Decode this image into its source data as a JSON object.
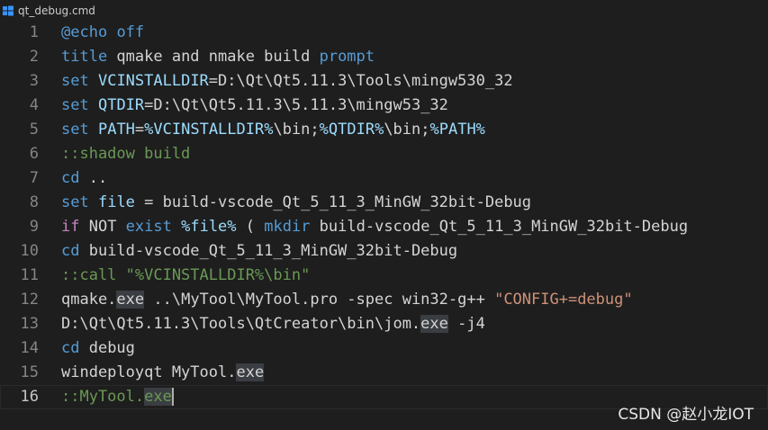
{
  "tab": {
    "label": "qt_debug.cmd",
    "icon": "windows-cmd-icon",
    "icon_color": "#3794ff"
  },
  "editor": {
    "current_line": 16,
    "lines": [
      {
        "n": "1",
        "t": [
          {
            "c": "kw",
            "v": "@echo"
          },
          {
            "v": " "
          },
          {
            "c": "kw",
            "v": "off"
          }
        ]
      },
      {
        "n": "2",
        "t": [
          {
            "c": "kw",
            "v": "title"
          },
          {
            "v": " qmake and nmake build "
          },
          {
            "c": "kw",
            "v": "prompt"
          }
        ]
      },
      {
        "n": "3",
        "t": [
          {
            "c": "kw",
            "v": "set"
          },
          {
            "v": " "
          },
          {
            "c": "var",
            "v": "VCINSTALLDIR"
          },
          {
            "v": "=D:\\Qt\\Qt5.11.3\\Tools\\mingw530_32"
          }
        ]
      },
      {
        "n": "4",
        "t": [
          {
            "c": "kw",
            "v": "set"
          },
          {
            "v": " "
          },
          {
            "c": "var",
            "v": "QTDIR"
          },
          {
            "v": "=D:\\Qt\\Qt5.11.3\\5.11.3\\mingw53_32"
          }
        ]
      },
      {
        "n": "5",
        "t": [
          {
            "c": "kw",
            "v": "set"
          },
          {
            "v": " "
          },
          {
            "c": "var",
            "v": "PATH"
          },
          {
            "v": "="
          },
          {
            "c": "var",
            "v": "%VCINSTALLDIR%"
          },
          {
            "v": "\\bin;"
          },
          {
            "c": "var",
            "v": "%QTDIR%"
          },
          {
            "v": "\\bin;"
          },
          {
            "c": "var",
            "v": "%PATH%"
          }
        ]
      },
      {
        "n": "6",
        "t": [
          {
            "c": "cm",
            "v": "::shadow build"
          }
        ]
      },
      {
        "n": "7",
        "t": [
          {
            "c": "kw",
            "v": "cd"
          },
          {
            "v": " .."
          }
        ]
      },
      {
        "n": "8",
        "t": [
          {
            "c": "kw",
            "v": "set"
          },
          {
            "v": " "
          },
          {
            "c": "var",
            "v": "file"
          },
          {
            "v": " = build-vscode_Qt_5_11_3_MinGW_32bit-Debug"
          }
        ]
      },
      {
        "n": "9",
        "t": [
          {
            "c": "kw2",
            "v": "if"
          },
          {
            "v": " NOT "
          },
          {
            "c": "kw",
            "v": "exist"
          },
          {
            "v": " "
          },
          {
            "c": "var",
            "v": "%file%"
          },
          {
            "v": " ( "
          },
          {
            "c": "kw",
            "v": "mkdir"
          },
          {
            "v": " build-vscode_Qt_5_11_3_MinGW_32bit-Debug"
          }
        ]
      },
      {
        "n": "10",
        "t": [
          {
            "c": "kw",
            "v": "cd"
          },
          {
            "v": " build-vscode_Qt_5_11_3_MinGW_32bit-Debug"
          }
        ]
      },
      {
        "n": "11",
        "t": [
          {
            "c": "cm",
            "v": "::call \"%VCINSTALLDIR%\\bin\""
          }
        ]
      },
      {
        "n": "12",
        "t": [
          {
            "v": "qmake."
          },
          {
            "c": "hl",
            "v": "exe"
          },
          {
            "v": " ..\\MyTool\\MyTool.pro -spec win32-g++ "
          },
          {
            "c": "str",
            "v": "\"CONFIG+=debug\""
          }
        ]
      },
      {
        "n": "13",
        "t": [
          {
            "v": "D:\\Qt\\Qt5.11.3\\Tools\\QtCreator\\bin\\jom."
          },
          {
            "c": "hl",
            "v": "exe"
          },
          {
            "v": " -j4"
          }
        ]
      },
      {
        "n": "14",
        "t": [
          {
            "c": "kw",
            "v": "cd"
          },
          {
            "v": " debug"
          }
        ]
      },
      {
        "n": "15",
        "t": [
          {
            "v": "windeployqt MyTool."
          },
          {
            "c": "hl",
            "v": "exe"
          }
        ]
      },
      {
        "n": "16",
        "t": [
          {
            "c": "cm",
            "v": "::MyTool."
          },
          {
            "c": "cm hl",
            "v": "exe"
          }
        ]
      }
    ]
  },
  "watermark": "CSDN @赵小龙IOT",
  "colors": {
    "background": "#1e1e1e",
    "keyword": "#569cd6",
    "control": "#c586c0",
    "variable": "#9cdcfe",
    "comment": "#6a9955",
    "string": "#ce9178",
    "text": "#d4d4d4",
    "line_number": "#858585"
  }
}
